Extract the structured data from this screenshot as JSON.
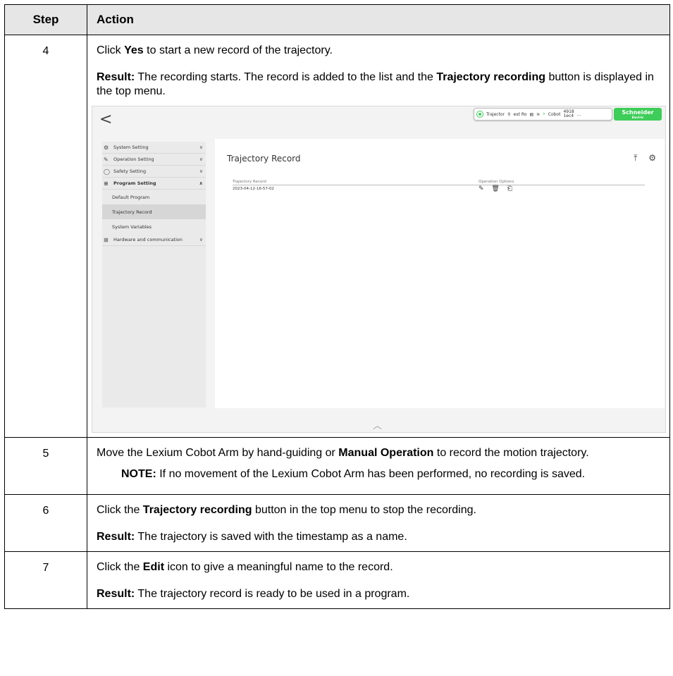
{
  "headers": {
    "step": "Step",
    "action": "Action"
  },
  "step4": {
    "num": "4",
    "line1_pre": "Click ",
    "line1_bold": "Yes",
    "line1_post": " to start a new record of the trajectory.",
    "result_label": "Result:",
    "result_pre": " The recording starts. The record is added to the list and the ",
    "result_bold": "Trajectory recording",
    "result_post": " button is displayed in the top menu."
  },
  "screenshot": {
    "back": "<",
    "topbar": {
      "rec_label": "Trajector",
      "item2": "ext Ro",
      "cobot": "Cobot",
      "counter_top": "4918",
      "counter_bottom": "1ec4",
      "more": "..."
    },
    "logo": {
      "brand": "Schneider",
      "sub": "Electric"
    },
    "sidebar": [
      {
        "label": "System Setting",
        "icon": "⚙",
        "chev": "∨"
      },
      {
        "label": "Operation Setting",
        "icon": "✎",
        "chev": "∨"
      },
      {
        "label": "Safety Setting",
        "icon": "◯",
        "chev": "∨"
      },
      {
        "label": "Program Setting",
        "icon": "≡",
        "chev": "∧"
      },
      {
        "label": "Default Program"
      },
      {
        "label": "Trajectory Record"
      },
      {
        "label": "System Variables"
      },
      {
        "label": "Hardware and communication",
        "icon": "⊞",
        "chev": "∨"
      }
    ],
    "page_title": "Trajectory Record",
    "tools": "⤒ ⚙",
    "col1": "Trajectory Record",
    "col2": "Operation Options",
    "row_name": "2023-04-12-16-57-02",
    "row_ops": "✎ 🗑 ⎗",
    "bottom_chevron": "︿"
  },
  "step5": {
    "num": "5",
    "pre": "Move the Lexium Cobot Arm by hand-guiding or ",
    "bold": "Manual Operation",
    "post": " to record the motion trajectory.",
    "note_label": "NOTE:",
    "note_text": " If no movement of the Lexium Cobot Arm has been performed, no recording is saved."
  },
  "step6": {
    "num": "6",
    "pre": "Click the ",
    "bold": "Trajectory recording",
    "post": " button in the top menu to stop the recording.",
    "result_label": "Result:",
    "result_text": " The trajectory is saved with the timestamp as a name."
  },
  "step7": {
    "num": "7",
    "pre": "Click the ",
    "bold": "Edit",
    "post": " icon to give a meaningful name to the record.",
    "result_label": "Result:",
    "result_text": " The trajectory record is ready to be used in a program."
  }
}
